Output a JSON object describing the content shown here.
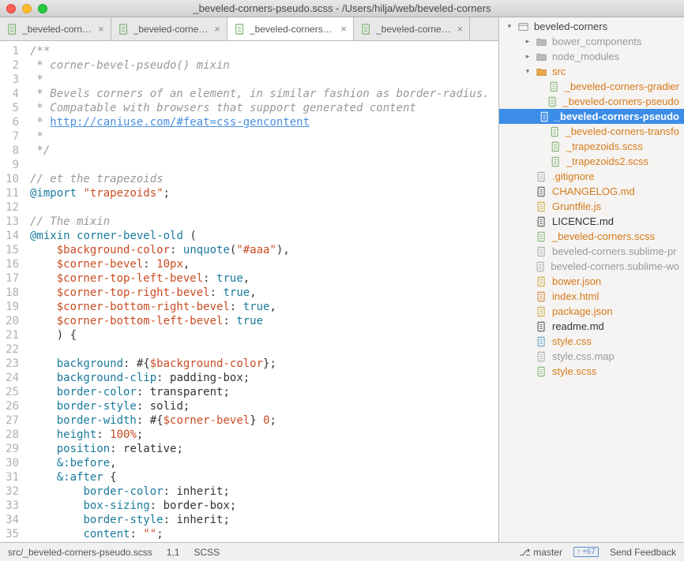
{
  "window": {
    "title": "_beveled-corners-pseudo.scss - /Users/hilja/web/beveled-corners"
  },
  "tabs": [
    {
      "label": "_beveled-corn…",
      "icon": "scss",
      "active": false
    },
    {
      "label": "_beveled-corne…",
      "icon": "scss",
      "active": false
    },
    {
      "label": "_beveled-corners-pseudo…",
      "icon": "scss",
      "active": true
    },
    {
      "label": "_beveled-corne…",
      "icon": "scss",
      "active": false
    }
  ],
  "code": {
    "lines": [
      {
        "n": 1,
        "html": "<span class='c-com'>/**</span>"
      },
      {
        "n": 2,
        "html": "<span class='c-com'> * corner-bevel-pseudo() mixin</span>"
      },
      {
        "n": 3,
        "html": "<span class='c-com'> *</span>"
      },
      {
        "n": 4,
        "html": "<span class='c-com'> * Bevels corners of an element, in similar fashion as border-radius.</span>"
      },
      {
        "n": 5,
        "html": "<span class='c-com'> * Compatable with browsers that support generated content</span>"
      },
      {
        "n": 6,
        "html": "<span class='c-com'> * </span><span class='c-link'>http://caniuse.com/#feat=css-gencontent</span>"
      },
      {
        "n": 7,
        "html": "<span class='c-com'> *</span>"
      },
      {
        "n": 8,
        "html": "<span class='c-com'> */</span>"
      },
      {
        "n": 9,
        "html": ""
      },
      {
        "n": 10,
        "html": "<span class='c-com'>// et the trapezoids</span>"
      },
      {
        "n": 11,
        "html": "<span class='c-at'>@import</span> <span class='c-str'>\"trapezoids\"</span><span class='c-punc'>;</span>"
      },
      {
        "n": 12,
        "html": ""
      },
      {
        "n": 13,
        "html": "<span class='c-com'>// The mixin</span>"
      },
      {
        "n": 14,
        "html": "<span class='c-at'>@mixin</span> <span class='c-fn'>corner-bevel-old</span> <span class='c-punc'>(</span>"
      },
      {
        "n": 15,
        "html": "    <span class='c-var'>$background-color</span><span class='c-punc'>:</span> <span class='c-kw'>unquote</span><span class='c-punc'>(</span><span class='c-str'>\"#aaa\"</span><span class='c-punc'>),</span>"
      },
      {
        "n": 16,
        "html": "    <span class='c-var'>$corner-bevel</span><span class='c-punc'>:</span> <span class='c-num'>10px</span><span class='c-punc'>,</span>"
      },
      {
        "n": 17,
        "html": "    <span class='c-var'>$corner-top-left-bevel</span><span class='c-punc'>:</span> <span class='c-kw'>true</span><span class='c-punc'>,</span>"
      },
      {
        "n": 18,
        "html": "    <span class='c-var'>$corner-top-right-bevel</span><span class='c-punc'>:</span> <span class='c-kw'>true</span><span class='c-punc'>,</span>"
      },
      {
        "n": 19,
        "html": "    <span class='c-var'>$corner-bottom-right-bevel</span><span class='c-punc'>:</span> <span class='c-kw'>true</span><span class='c-punc'>,</span>"
      },
      {
        "n": 20,
        "html": "    <span class='c-var'>$corner-bottom-left-bevel</span><span class='c-punc'>:</span> <span class='c-kw'>true</span>"
      },
      {
        "n": 21,
        "html": "    <span class='c-punc'>) {</span>"
      },
      {
        "n": 22,
        "html": ""
      },
      {
        "n": 23,
        "html": "    <span class='c-prop'>background</span><span class='c-punc'>:</span> <span class='c-punc'>#{</span><span class='c-var'>$background-color</span><span class='c-punc'>};</span>"
      },
      {
        "n": 24,
        "html": "    <span class='c-prop'>background-clip</span><span class='c-punc'>:</span> <span class='c-val'>padding-box</span><span class='c-punc'>;</span>"
      },
      {
        "n": 25,
        "html": "    <span class='c-prop'>border-color</span><span class='c-punc'>:</span> <span class='c-val'>transparent</span><span class='c-punc'>;</span>"
      },
      {
        "n": 26,
        "html": "    <span class='c-prop'>border-style</span><span class='c-punc'>:</span> <span class='c-val'>solid</span><span class='c-punc'>;</span>"
      },
      {
        "n": 27,
        "html": "    <span class='c-prop'>border-width</span><span class='c-punc'>:</span> <span class='c-punc'>#{</span><span class='c-var'>$corner-bevel</span><span class='c-punc'>}</span> <span class='c-num'>0</span><span class='c-punc'>;</span>"
      },
      {
        "n": 28,
        "html": "    <span class='c-prop'>height</span><span class='c-punc'>:</span> <span class='c-num'>100%</span><span class='c-punc'>;</span>"
      },
      {
        "n": 29,
        "html": "    <span class='c-prop'>position</span><span class='c-punc'>:</span> <span class='c-val'>relative</span><span class='c-punc'>;</span>"
      },
      {
        "n": 30,
        "html": "    <span class='c-at'>&amp;</span><span class='c-prop'>:before</span><span class='c-punc'>,</span>"
      },
      {
        "n": 31,
        "html": "    <span class='c-at'>&amp;</span><span class='c-prop'>:after</span> <span class='c-punc'>{</span>"
      },
      {
        "n": 32,
        "html": "        <span class='c-prop'>border-color</span><span class='c-punc'>:</span> <span class='c-val'>inherit</span><span class='c-punc'>;</span>"
      },
      {
        "n": 33,
        "html": "        <span class='c-prop'>box-sizing</span><span class='c-punc'>:</span> <span class='c-val'>border-box</span><span class='c-punc'>;</span>"
      },
      {
        "n": 34,
        "html": "        <span class='c-prop'>border-style</span><span class='c-punc'>:</span> <span class='c-val'>inherit</span><span class='c-punc'>;</span>"
      },
      {
        "n": 35,
        "html": "        <span class='c-prop'>content</span><span class='c-punc'>:</span> <span class='c-str'>\"\"</span><span class='c-punc'>;</span>"
      }
    ]
  },
  "sidebar": {
    "root": "beveled-corners",
    "items": [
      {
        "name": "bower_components",
        "type": "folder",
        "indent": 1,
        "open": false,
        "color": "gray"
      },
      {
        "name": "node_modules",
        "type": "folder",
        "indent": 1,
        "open": false,
        "color": "gray"
      },
      {
        "name": "src",
        "type": "folder",
        "indent": 1,
        "open": true,
        "color": "orange"
      },
      {
        "name": "_beveled-corners-gradient",
        "type": "scss",
        "indent": 2,
        "color": "orange",
        "trunc": "_beveled-corners-gradier"
      },
      {
        "name": "_beveled-corners-pseudo",
        "type": "scss",
        "indent": 2,
        "color": "orange",
        "trunc": "_beveled-corners-pseudo"
      },
      {
        "name": "_beveled-corners-pseudo",
        "type": "scss",
        "indent": 2,
        "color": "orange",
        "selected": true,
        "trunc": "_beveled-corners-pseudo"
      },
      {
        "name": "_beveled-corners-transform",
        "type": "scss",
        "indent": 2,
        "color": "orange",
        "trunc": "_beveled-corners-transfo"
      },
      {
        "name": "_trapezoids.scss",
        "type": "scss",
        "indent": 2,
        "color": "orange"
      },
      {
        "name": "_trapezoids2.scss",
        "type": "scss",
        "indent": 2,
        "color": "orange"
      },
      {
        "name": ".gitignore",
        "type": "file",
        "indent": 1,
        "color": "orange"
      },
      {
        "name": "CHANGELOG.md",
        "type": "md",
        "indent": 1,
        "color": "orange"
      },
      {
        "name": "Gruntfile.js",
        "type": "js",
        "indent": 1,
        "color": "orange"
      },
      {
        "name": "LICENCE.md",
        "type": "md",
        "indent": 1,
        "color": "black"
      },
      {
        "name": "_beveled-corners.scss",
        "type": "scss",
        "indent": 1,
        "color": "orange"
      },
      {
        "name": "beveled-corners.sublime-pr",
        "type": "file",
        "indent": 1,
        "color": "gray"
      },
      {
        "name": "beveled-corners.sublime-wo",
        "type": "file",
        "indent": 1,
        "color": "gray"
      },
      {
        "name": "bower.json",
        "type": "json",
        "indent": 1,
        "color": "orange"
      },
      {
        "name": "index.html",
        "type": "html",
        "indent": 1,
        "color": "orange"
      },
      {
        "name": "package.json",
        "type": "json",
        "indent": 1,
        "color": "orange"
      },
      {
        "name": "readme.md",
        "type": "md",
        "indent": 1,
        "color": "black"
      },
      {
        "name": "style.css",
        "type": "css",
        "indent": 1,
        "color": "orange"
      },
      {
        "name": "style.css.map",
        "type": "file",
        "indent": 1,
        "color": "gray"
      },
      {
        "name": "style.scss",
        "type": "scss",
        "indent": 1,
        "color": "orange"
      }
    ]
  },
  "statusbar": {
    "path": "src/_beveled-corners-pseudo.scss",
    "pos": "1,1",
    "lang": "SCSS",
    "branch": "master",
    "ahead": "+67",
    "feedback": "Send Feedback"
  },
  "icons": {
    "branch": "⎇"
  }
}
